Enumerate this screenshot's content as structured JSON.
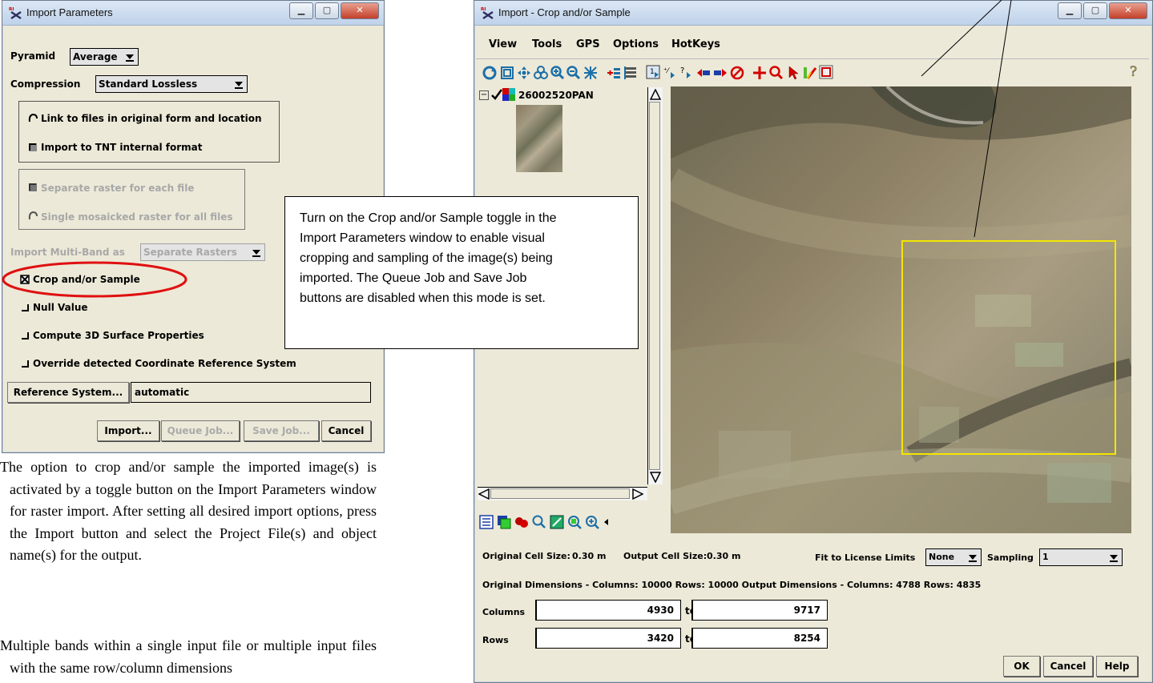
{
  "import_params": {
    "title": "Import Parameters",
    "pyramid_label": "Pyramid",
    "pyramid_value": "Average",
    "compression_label": "Compression",
    "compression_value": "Standard Lossless",
    "link_files": "Link to files in original form and location",
    "import_internal": "Import to TNT internal format",
    "separate_raster": "Separate raster for each file",
    "single_mosaic": "Single mosaicked raster for all files",
    "multiband_label": "Import Multi-Band as",
    "multiband_value": "Separate Rasters",
    "crop_sample": "Crop and/or Sample",
    "null_value": "Null Value",
    "compute_3d": "Compute 3D Surface Properties",
    "override_crs": "Override detected Coordinate Reference System",
    "ref_system_button": "Reference System...",
    "ref_system_value": "automatic",
    "import_button": "Import...",
    "queue_button": "Queue Job...",
    "save_button": "Save Job...",
    "cancel_button": "Cancel"
  },
  "callout": {
    "text": "Turn on the Crop and/or Sample toggle in the Import Parameters window to enable visual cropping and sampling of the image(s) being imported.  The Queue Job and Save Job buttons are disabled when this mode is set."
  },
  "body_text": {
    "para1": "The option to crop and/or sample the imported image(s) is activated by a toggle button on the Import Parameters window for raster import.  After setting all desired import options, press the Import button and select the Project File(s) and object name(s) for the output.",
    "para2": "Multiple bands within a single input file or multiple input files with the same row/column dimensions"
  },
  "crop_window": {
    "title": "Import - Crop and/or Sample",
    "menu": [
      "View",
      "Tools",
      "GPS",
      "Options",
      "HotKeys"
    ],
    "layer_name": "26002520PAN",
    "orig_cell_size_label": "Original Cell Size:",
    "orig_cell_size": "0.30 m",
    "out_cell_size_label": "Output Cell Size:",
    "out_cell_size": "0.30 m",
    "fit_label": "Fit to License Limits",
    "fit_value": "None",
    "sampling_label": "Sampling",
    "sampling_value": "1",
    "dims_text": "Original Dimensions - Columns: 10000  Rows: 10000  Output Dimensions - Columns: 4788  Rows: 4835",
    "columns_label": "Columns",
    "columns_from": "4930",
    "columns_to": "9717",
    "rows_label": "Rows",
    "rows_from": "3420",
    "rows_to": "8254",
    "to_label": "to",
    "ok_button": "OK",
    "cancel_button": "Cancel",
    "help_button": "Help"
  },
  "colors": {
    "window_bg": "#ece9d8",
    "highlight_ellipse": "#e01010",
    "crop_rect": "#f4e600",
    "disabled_text": "#a8a8a8"
  }
}
